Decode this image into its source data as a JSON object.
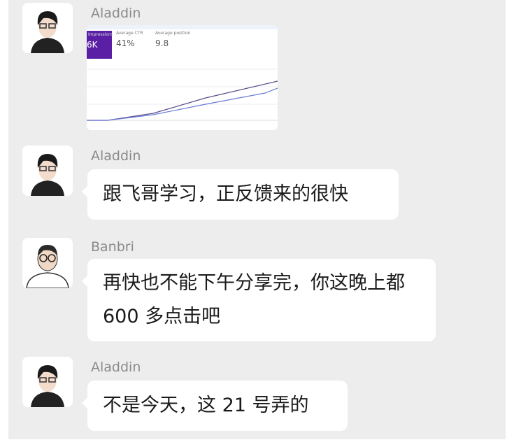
{
  "messages": [
    {
      "sender": "Aladdin",
      "type": "image",
      "image": {
        "metrics": [
          {
            "label": "Impressions",
            "value": "6K"
          },
          {
            "label": "Average CTR",
            "value": "41%"
          },
          {
            "label": "Average position",
            "value": "9.8"
          }
        ]
      }
    },
    {
      "sender": "Aladdin",
      "type": "text",
      "text": "跟飞哥学习，正反馈来的很快"
    },
    {
      "sender": "Banbri",
      "type": "text",
      "text": "再快也不能下午分享完，你这晚上都 600 多点击吧"
    },
    {
      "sender": "Aladdin",
      "type": "text",
      "text": "不是今天，这 21 号弄的"
    }
  ],
  "colors": {
    "accent": "#5b1fa6",
    "background": "#ededed"
  }
}
